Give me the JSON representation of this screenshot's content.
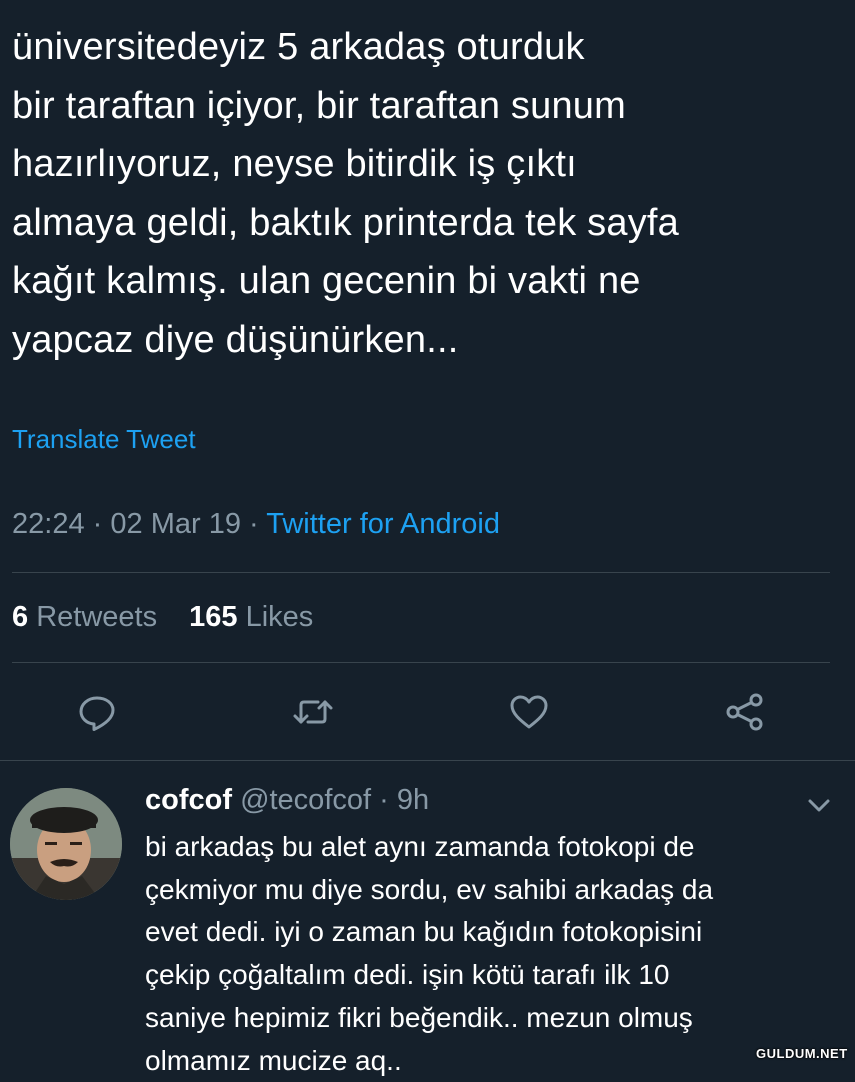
{
  "tweet": {
    "text": "üniversitedeyiz 5 arkadaş oturduk\nbir taraftan içiyor, bir taraftan sunum\nhazırlıyoruz, neyse bitirdik iş çıktı\nalmaya geldi, baktık printerda tek sayfa\nkağıt kalmış. ulan gecenin bi vakti ne\nyapcaz diye düşünürken...",
    "translate_label": "Translate Tweet",
    "time": "22:24",
    "separator": "·",
    "date": "02 Mar 19",
    "source": "Twitter for Android",
    "retweets_count": "6",
    "retweets_label": "Retweets",
    "likes_count": "165",
    "likes_label": "Likes"
  },
  "actions": {
    "icons": [
      "reply-icon",
      "retweet-icon",
      "like-icon",
      "share-icon"
    ]
  },
  "reply": {
    "name": "cofcof",
    "handle": "@tecofcof",
    "separator": "·",
    "time": "9h",
    "text": "bi arkadaş bu alet aynı zamanda fotokopi de\nçekmiyor mu diye sordu, ev sahibi arkadaş da\nevet dedi. iyi o zaman bu kağıdın fotokopisini\nçekip çoğaltalım dedi. işin kötü tarafı ilk 10\nsaniye hepimiz fikri beğendik.. mezun olmuş\nolmamız mucize aq.."
  },
  "watermark": "GULDUM.NET",
  "colors": {
    "background": "#15202b",
    "text": "#ffffff",
    "muted": "#8899a6",
    "accent": "#1da1f2",
    "divider": "#38444d"
  }
}
